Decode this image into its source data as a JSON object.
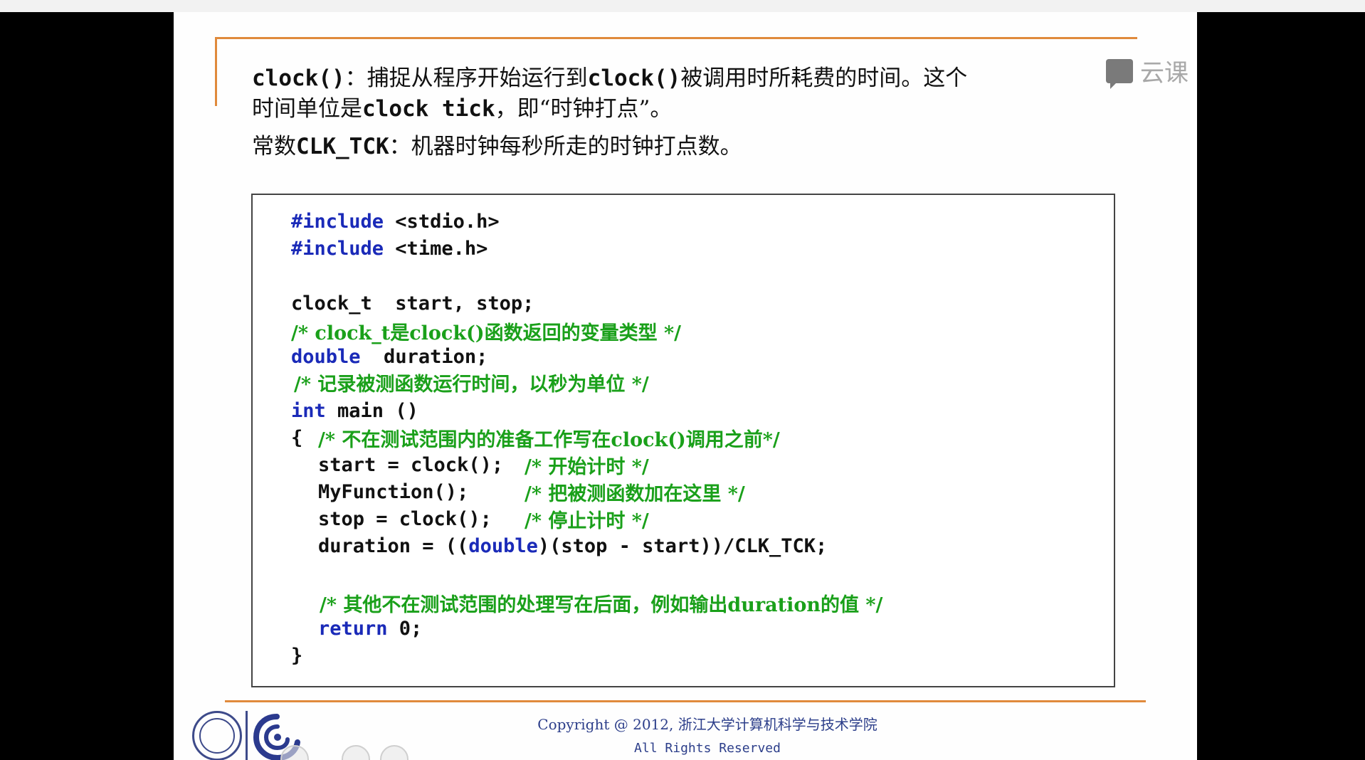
{
  "watermark": {
    "text": "云课"
  },
  "intro": {
    "l1_code": "clock()",
    "l1_text": "：捕捉从程序开始运行到",
    "l1_code2": "clock()",
    "l1_text2": "被调用时所耗费的时间。这个",
    "l2_text": "时间单位是",
    "l2_code": "clock tick",
    "l2_text2": "，即“时钟打点”。",
    "l3_text": "常数",
    "l3_code": "CLK_TCK",
    "l3_text2": "：机器时钟每秒所走的时钟打点数。"
  },
  "code": {
    "inc1_kw": "#include",
    "inc1_rest": " <stdio.h>",
    "inc2_kw": "#include",
    "inc2_rest": " <time.h>",
    "decl1": "clock_t  start, stop;",
    "cm1": "/* clock_t是clock()函数返回的变量类型 */",
    "decl2_kw": "double",
    "decl2_rest": "  duration;",
    "cm2": "/* 记录被测函数运行时间，以秒为单位 */",
    "main_kw": "int",
    "main_rest": " main ()",
    "brace_open": "{",
    "cm3": "/* 不在测试范围内的准备工作写在clock()调用之前*/",
    "s1": "start = clock();",
    "cm4": "/* 开始计时 */",
    "s2": "MyFunction();",
    "cm5": "/* 把被测函数加在这里 */",
    "s3": "stop = clock();",
    "cm6": "/* 停止计时 */",
    "s4a": "duration = ((",
    "s4kw": "double",
    "s4b": ")(stop - start))/CLK_TCK;",
    "cm7": "/* 其他不在测试范围的处理写在后面，例如输出duration的值 */",
    "ret_kw": "return",
    "ret_rest": " 0;",
    "brace_close": "}"
  },
  "footer": {
    "copyright": "Copyright @ 2012, 浙江大学计算机科学与技术学院",
    "rights": "All Rights Reserved"
  }
}
